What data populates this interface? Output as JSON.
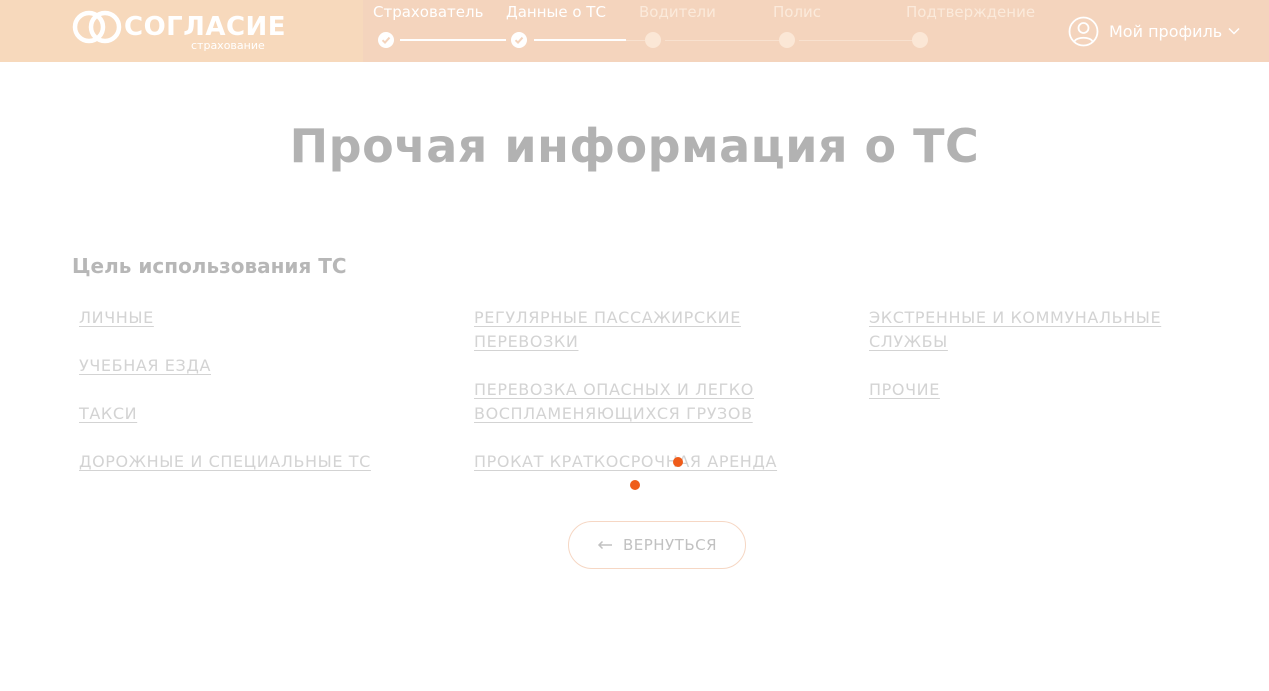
{
  "header": {
    "logo": {
      "name": "СОГЛАСИЕ",
      "tagline": "страхование",
      "icon": "rings-logo-icon"
    },
    "steps": [
      {
        "label": "Страхователь",
        "status": "done"
      },
      {
        "label": "Данные о ТС",
        "status": "done"
      },
      {
        "label": "Водители",
        "status": "todo"
      },
      {
        "label": "Полис",
        "status": "todo"
      },
      {
        "label": "Подтверждение",
        "status": "todo"
      }
    ],
    "profile": {
      "label": "Мой профиль",
      "icon": "user-circle-icon",
      "chevron": "chevron-down-icon"
    }
  },
  "main": {
    "title": "Прочая информация о ТС",
    "section_title": "Цель использования ТС",
    "options": {
      "col1": [
        "ЛИЧНЫЕ",
        "УЧЕБНАЯ ЕЗДА",
        "ТАКСИ",
        "ДОРОЖНЫЕ И СПЕЦИАЛЬНЫЕ ТС"
      ],
      "col2": [
        "РЕГУЛЯРНЫЕ ПАССАЖИРСКИЕ",
        "ПЕРЕВОЗКИ",
        "ПЕРЕВОЗКА ОПАСНЫХ И ЛЕГКО",
        "ВОСПЛАМЕНЯЮЩИХСЯ ГРУЗОВ",
        "ПРОКАТ КРАТКОСРОЧНАЯ АРЕНДА"
      ],
      "col3": [
        "ЭКСТРЕННЫЕ И КОММУНАЛЬНЫЕ",
        "СЛУЖБЫ",
        "ПРОЧИЕ"
      ]
    },
    "back_button": {
      "label": "ВЕРНУТЬСЯ",
      "icon": "arrow-left-icon"
    }
  },
  "colors": {
    "header_bg": "#f7d9bc",
    "accent": "#ef5c1a",
    "muted_text": "#d3d3d3"
  }
}
